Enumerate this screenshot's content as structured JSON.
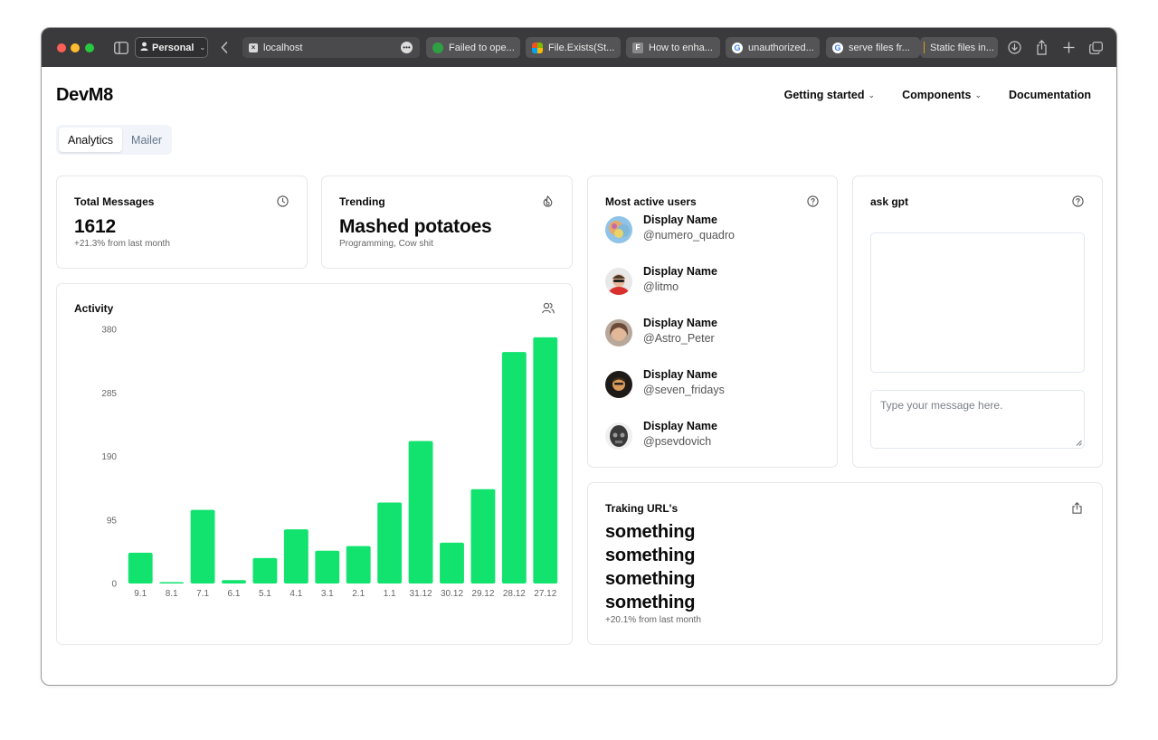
{
  "browser": {
    "profile": "Personal",
    "tabs": [
      {
        "label": "localhost",
        "favicon": "x-icon"
      },
      {
        "label": "Failed to ope...",
        "favicon": "github-icon"
      },
      {
        "label": "File.Exists(St...",
        "favicon": "microsoft-icon"
      },
      {
        "label": "How to enha...",
        "favicon": "f-icon"
      },
      {
        "label": "unauthorized...",
        "favicon": "google-icon"
      },
      {
        "label": "serve files fr...",
        "favicon": "google-icon"
      },
      {
        "label": "Static files in...",
        "favicon": "none"
      }
    ]
  },
  "app": {
    "brand": "DevM8",
    "nav": [
      {
        "label": "Getting started",
        "has_dropdown": true
      },
      {
        "label": "Components",
        "has_dropdown": true
      },
      {
        "label": "Documentation",
        "has_dropdown": false
      }
    ],
    "segments": [
      {
        "label": "Analytics",
        "active": true
      },
      {
        "label": "Mailer",
        "active": false
      }
    ]
  },
  "cards": {
    "total_messages": {
      "title": "Total Messages",
      "value": "1612",
      "sub": "+21.3% from last month",
      "icon": "clock-icon"
    },
    "trending": {
      "title": "Trending",
      "value": "Mashed potatoes",
      "sub": "Programming, Cow shit",
      "icon": "flame-icon"
    },
    "activity": {
      "title": "Activity",
      "icon": "users-icon"
    },
    "most_active": {
      "title": "Most active users",
      "icon": "help-icon",
      "users": [
        {
          "name": "Display Name",
          "handle": "@numero_quadro"
        },
        {
          "name": "Display Name",
          "handle": "@litmo"
        },
        {
          "name": "Display Name",
          "handle": "@Astro_Peter"
        },
        {
          "name": "Display Name",
          "handle": "@seven_fridays"
        },
        {
          "name": "Display Name",
          "handle": "@psevdovich"
        }
      ]
    },
    "ask_gpt": {
      "title": "ask gpt",
      "icon": "help-icon",
      "input_placeholder": "Type your message here."
    },
    "tracking": {
      "title": "Traking URL's",
      "icon": "share-icon",
      "items": [
        "something",
        "something",
        "something",
        "something"
      ],
      "sub": "+20.1% from last month"
    }
  },
  "chart_data": {
    "type": "bar",
    "categories": [
      "9.1",
      "8.1",
      "7.1",
      "6.1",
      "5.1",
      "4.1",
      "3.1",
      "2.1",
      "1.1",
      "31.12",
      "30.12",
      "29.12",
      "28.12",
      "27.12"
    ],
    "values": [
      46,
      2,
      110,
      5,
      38,
      81,
      49,
      56,
      121,
      213,
      61,
      141,
      346,
      368
    ],
    "yticks": [
      0,
      95,
      190,
      285,
      380
    ],
    "ylim": [
      0,
      380
    ],
    "bar_color": "#12e26e",
    "grid": false
  }
}
